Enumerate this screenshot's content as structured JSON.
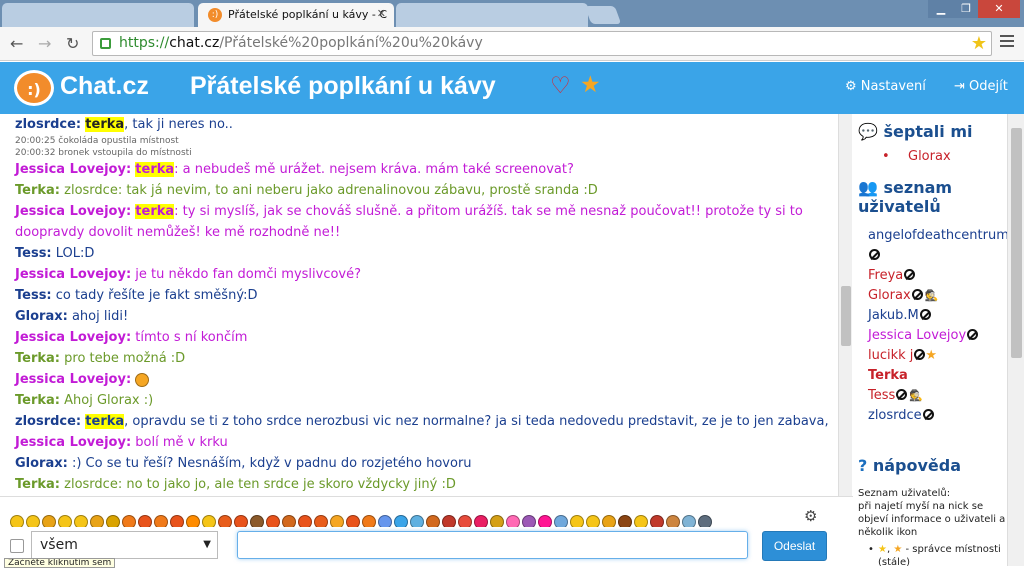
{
  "browser": {
    "tabs": [
      {
        "title": ""
      },
      {
        "title": "Přátelské poplkání u kávy - C"
      },
      {
        "title": ""
      }
    ],
    "favicon": ":)",
    "tab_close": "✕",
    "window_controls": {
      "minimize": "▁",
      "maximize": "❐",
      "close": "✕"
    },
    "nav": {
      "back": "←",
      "forward": "→",
      "reload": "↻"
    },
    "url": {
      "scheme": "https://",
      "host": "chat.cz",
      "path": "/Přátelské%20poplkání%20u%20kávy"
    }
  },
  "header": {
    "logo_mark": ":)",
    "logo_text": "Chat.cz",
    "room_title": "Přátelské poplkání u kávy",
    "settings_label": "Nastavení",
    "logout_label": "Odejít"
  },
  "messages": [
    {
      "nick": "zlosrdce:",
      "highlight": "terka",
      "text": ", tak ji neres no.."
    },
    {
      "sys": "20:00:25 čokoláda opustila místnost"
    },
    {
      "sys": "20:00:32 bronek vstoupila do místnosti"
    },
    {
      "nick": "Jessica Lovejoy:",
      "highlight": "terka",
      "text": ": a nebudeš mě urážet. nejsem kráva. mám také screenovat?"
    },
    {
      "nick": "Terka:",
      "text": "zlosrdce: tak já nevim, to ani neberu jako adrenalinovou zábavu, prostě sranda :D"
    },
    {
      "nick": "Jessica Lovejoy:",
      "highlight": "terka",
      "text": ": ty si myslíš, jak se chováš slušně. a přitom urážíš. tak se mě nesnaž poučovat!! protože ty si to doopravdy dovolit nemůžeš! ke mě rozhodně ne!!"
    },
    {
      "nick": "Tess:",
      "text": "LOL:D"
    },
    {
      "nick": "Jessica Lovejoy:",
      "text": "je tu někdo fan domči myslivcové?"
    },
    {
      "nick": "Tess:",
      "text": "co tady řešíte je fakt směšný:D"
    },
    {
      "nick": "Glorax:",
      "text": "ahoj lidi!"
    },
    {
      "nick": "Jessica Lovejoy:",
      "text": "tímto s ní končím"
    },
    {
      "nick": "Terka:",
      "text": "pro tebe možná :D"
    },
    {
      "nick": "Jessica Lovejoy:",
      "text": ""
    },
    {
      "nick": "Terka:",
      "text": "Ahoj Glorax :)"
    },
    {
      "nick": "zlosrdce:",
      "highlight": "terka",
      "text": ", opravdu se ti z toho srdce nerozbusi vic nez normalne? ja si teda nedovedu predstavit, ze je to jen zabava,"
    },
    {
      "nick": "Jessica Lovejoy:",
      "text": "bolí mě v krku"
    },
    {
      "nick": "Glorax:",
      "text": ":) Co se tu řeší? Nesnáším, když v padnu do rozjetého hovoru"
    },
    {
      "nick": "Terka:",
      "text": "zlosrdce: no to jako jo, ale ten srdce je skoro vždycky jiný :D"
    }
  ],
  "sidebar": {
    "whisper_heading": "šeptali mi",
    "whispers": [
      "Glorax"
    ],
    "users_heading": "seznam uživatelů",
    "users": [
      {
        "name": "angelofdeathcentrum."
      },
      {
        "name": "Freya"
      },
      {
        "name": "Glorax"
      },
      {
        "name": "Jakub.M"
      },
      {
        "name": "Jessica Lovejoy"
      },
      {
        "name": "lucikk j"
      },
      {
        "name": "Terka"
      },
      {
        "name": "Tess"
      },
      {
        "name": "zlosrdce"
      }
    ],
    "help_heading": "nápověda",
    "help_line1": "Seznam uživatelů:",
    "help_line2": "při najetí myší na nick se objeví informace o uživateli a několik ikon",
    "help_item1": "- správce místnosti (stále)"
  },
  "composer": {
    "recipient": "všem",
    "send_label": "Odeslat",
    "tooltip": "Začněte kliknutím sem"
  },
  "colors": {
    "header_bg": "#3aa4e8",
    "nick_pink": "#c21bd6",
    "nick_green": "#6b9a2a",
    "nick_blue": "#1b3f8f",
    "highlight": "#ffff00",
    "send_button": "#2d8fd7"
  },
  "smiley_colors": [
    "#f5c518",
    "#f5c518",
    "#e8a317",
    "#f5c518",
    "#f5c518",
    "#e8a317",
    "#d9a300",
    "#f07a1a",
    "#e8531c",
    "#f07a1a",
    "#e8531c",
    "#ff8c00",
    "#f5c518",
    "#e85d1c",
    "#e8531c",
    "#8b5a2b",
    "#e8531c",
    "#d2691e",
    "#e8531c",
    "#e85d1c",
    "#f5a623",
    "#e8531c",
    "#f07a1a",
    "#6495ed",
    "#3aa4e8",
    "#5fb0e0",
    "#d2691e",
    "#c0392b",
    "#e74c3c",
    "#e91e63",
    "#d4a017",
    "#ff69b4",
    "#9b59b6",
    "#ff1493",
    "#6fa8dc",
    "#f5c518",
    "#f5c518",
    "#e8a317",
    "#8b4513",
    "#f5c518",
    "#c0392b",
    "#cd853f",
    "#7fb3d5",
    "#5d6d7e"
  ]
}
